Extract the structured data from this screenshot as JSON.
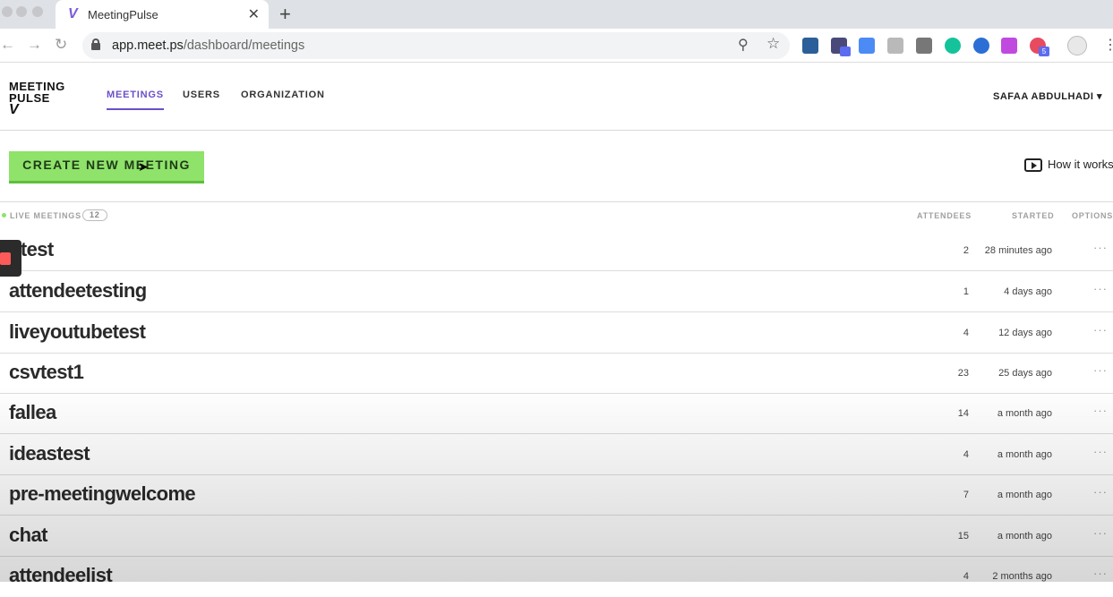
{
  "browser": {
    "tab_title": "MeetingPulse",
    "tab_favicon": "V",
    "url_domain": "app.meet.ps",
    "url_path": "/dashboard/meetings",
    "extension_badge": "5"
  },
  "app": {
    "logo_line1": "MEETING",
    "logo_line2": "PULSE",
    "logo_mark": "V",
    "nav": [
      {
        "label": "MEETINGS",
        "active": true
      },
      {
        "label": "USERS",
        "active": false
      },
      {
        "label": "ORGANIZATION",
        "active": false
      }
    ],
    "user_name": "SAFAA ABDULHADI",
    "user_caret": "▾",
    "accent_color": "#6b4fc8",
    "button_color": "#8fe26a"
  },
  "toolbar": {
    "create_label": "CREATE NEW MEETING",
    "how_label": "How it works"
  },
  "table": {
    "section_label": "LIVE MEETINGS",
    "count": "12",
    "columns": {
      "attendees": "ATTENDEES",
      "started": "STARTED",
      "options": "OPTIONS"
    },
    "rows": [
      {
        "name": "dtest",
        "attendees": "2",
        "started": "28 minutes ago",
        "options": "···"
      },
      {
        "name": "attendeetesting",
        "attendees": "1",
        "started": "4 days ago",
        "options": "···"
      },
      {
        "name": "liveyoutubetest",
        "attendees": "4",
        "started": "12 days ago",
        "options": "···"
      },
      {
        "name": "csvtest1",
        "attendees": "23",
        "started": "25 days ago",
        "options": "···"
      },
      {
        "name": "fallea",
        "attendees": "14",
        "started": "a month ago",
        "options": "···"
      },
      {
        "name": "ideastest",
        "attendees": "4",
        "started": "a month ago",
        "options": "···"
      },
      {
        "name": "pre-meetingwelcome",
        "attendees": "7",
        "started": "a month ago",
        "options": "···"
      },
      {
        "name": "chat",
        "attendees": "15",
        "started": "a month ago",
        "options": "···"
      },
      {
        "name": "attendeelist",
        "attendees": "4",
        "started": "2 months ago",
        "options": "···"
      }
    ]
  }
}
